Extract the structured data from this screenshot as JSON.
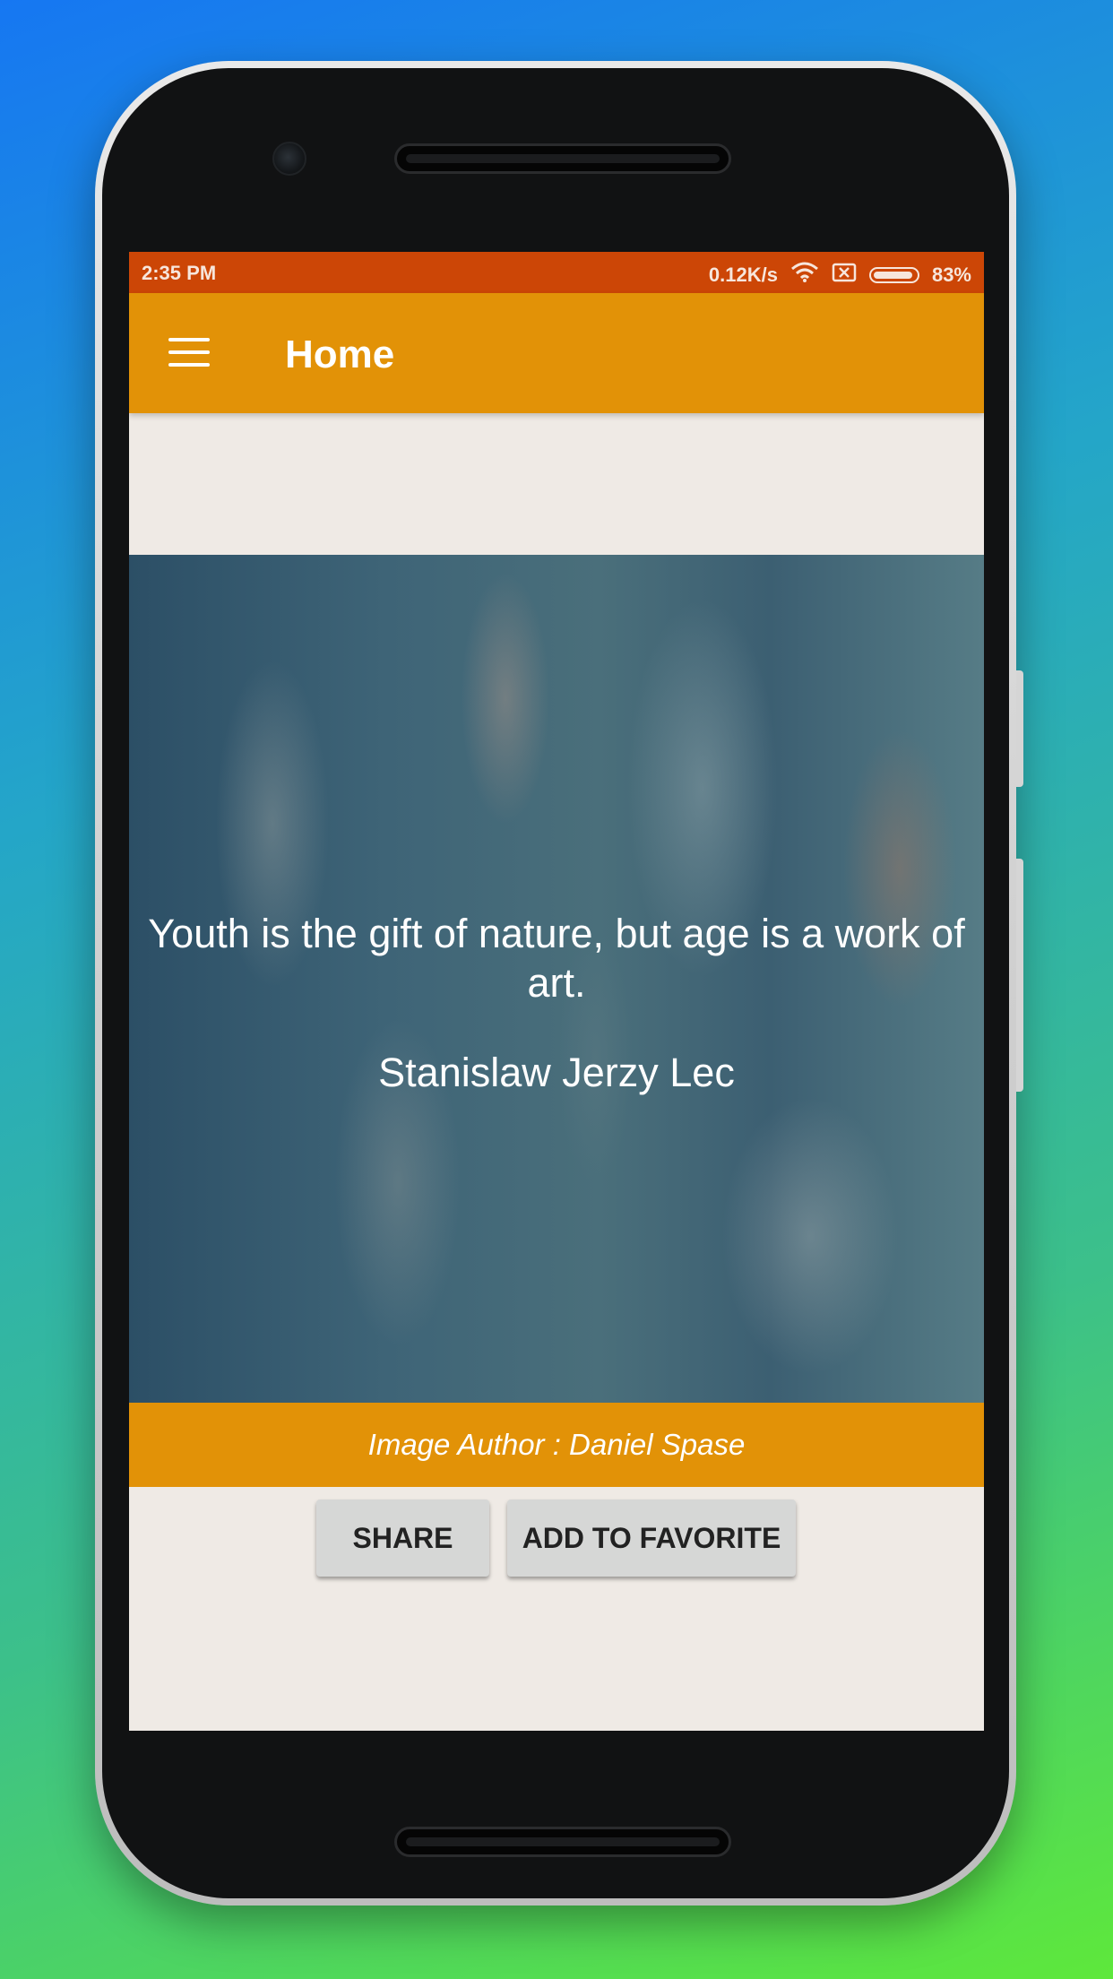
{
  "status_bar": {
    "time": "2:35 PM",
    "net_speed": "0.12K/s",
    "battery": "83%",
    "icons": [
      "wifi-icon",
      "sim-off-icon",
      "battery-icon"
    ]
  },
  "app_bar": {
    "title": "Home",
    "menu_icon": "hamburger-menu-icon",
    "color": "#e29207"
  },
  "quote": {
    "text": "Youth is the gift of nature, but age is a work of art.",
    "author": "Stanislaw Jerzy Lec"
  },
  "credit": {
    "text": "Image Author : Daniel Spase"
  },
  "actions": {
    "share_label": "SHARE",
    "favorite_label": "ADD TO FAVORITE"
  },
  "colors": {
    "status_bar": "#cc4606",
    "accent": "#e29207",
    "background": "#efeae5"
  }
}
